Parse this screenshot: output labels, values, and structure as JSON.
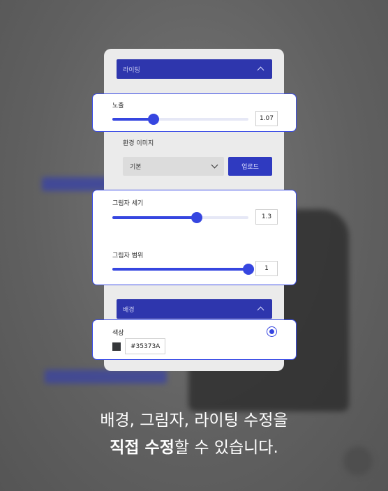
{
  "lighting": {
    "header": "라이팅"
  },
  "exposure": {
    "label": "노출",
    "value": "1.07",
    "fraction": 0.3
  },
  "environment": {
    "label": "환경 이미지",
    "select_value": "기본",
    "upload_label": "업로드"
  },
  "shadow_strength": {
    "label": "그림자 세기",
    "value": "1.3",
    "fraction": 0.62
  },
  "shadow_range": {
    "label": "그림자 범위",
    "value": "1",
    "fraction": 1.0
  },
  "background": {
    "header": "배경"
  },
  "color": {
    "label": "색상",
    "hex": "#35373A",
    "swatch": "#35373A",
    "selected": true
  },
  "caption": {
    "line1": "배경, 그림자, 라이팅 수정을",
    "line2_bold": "직접 수정",
    "line2_rest": "할 수 있습니다."
  },
  "colors": {
    "accent": "#3646E0",
    "header_bg": "#2E36AD"
  }
}
